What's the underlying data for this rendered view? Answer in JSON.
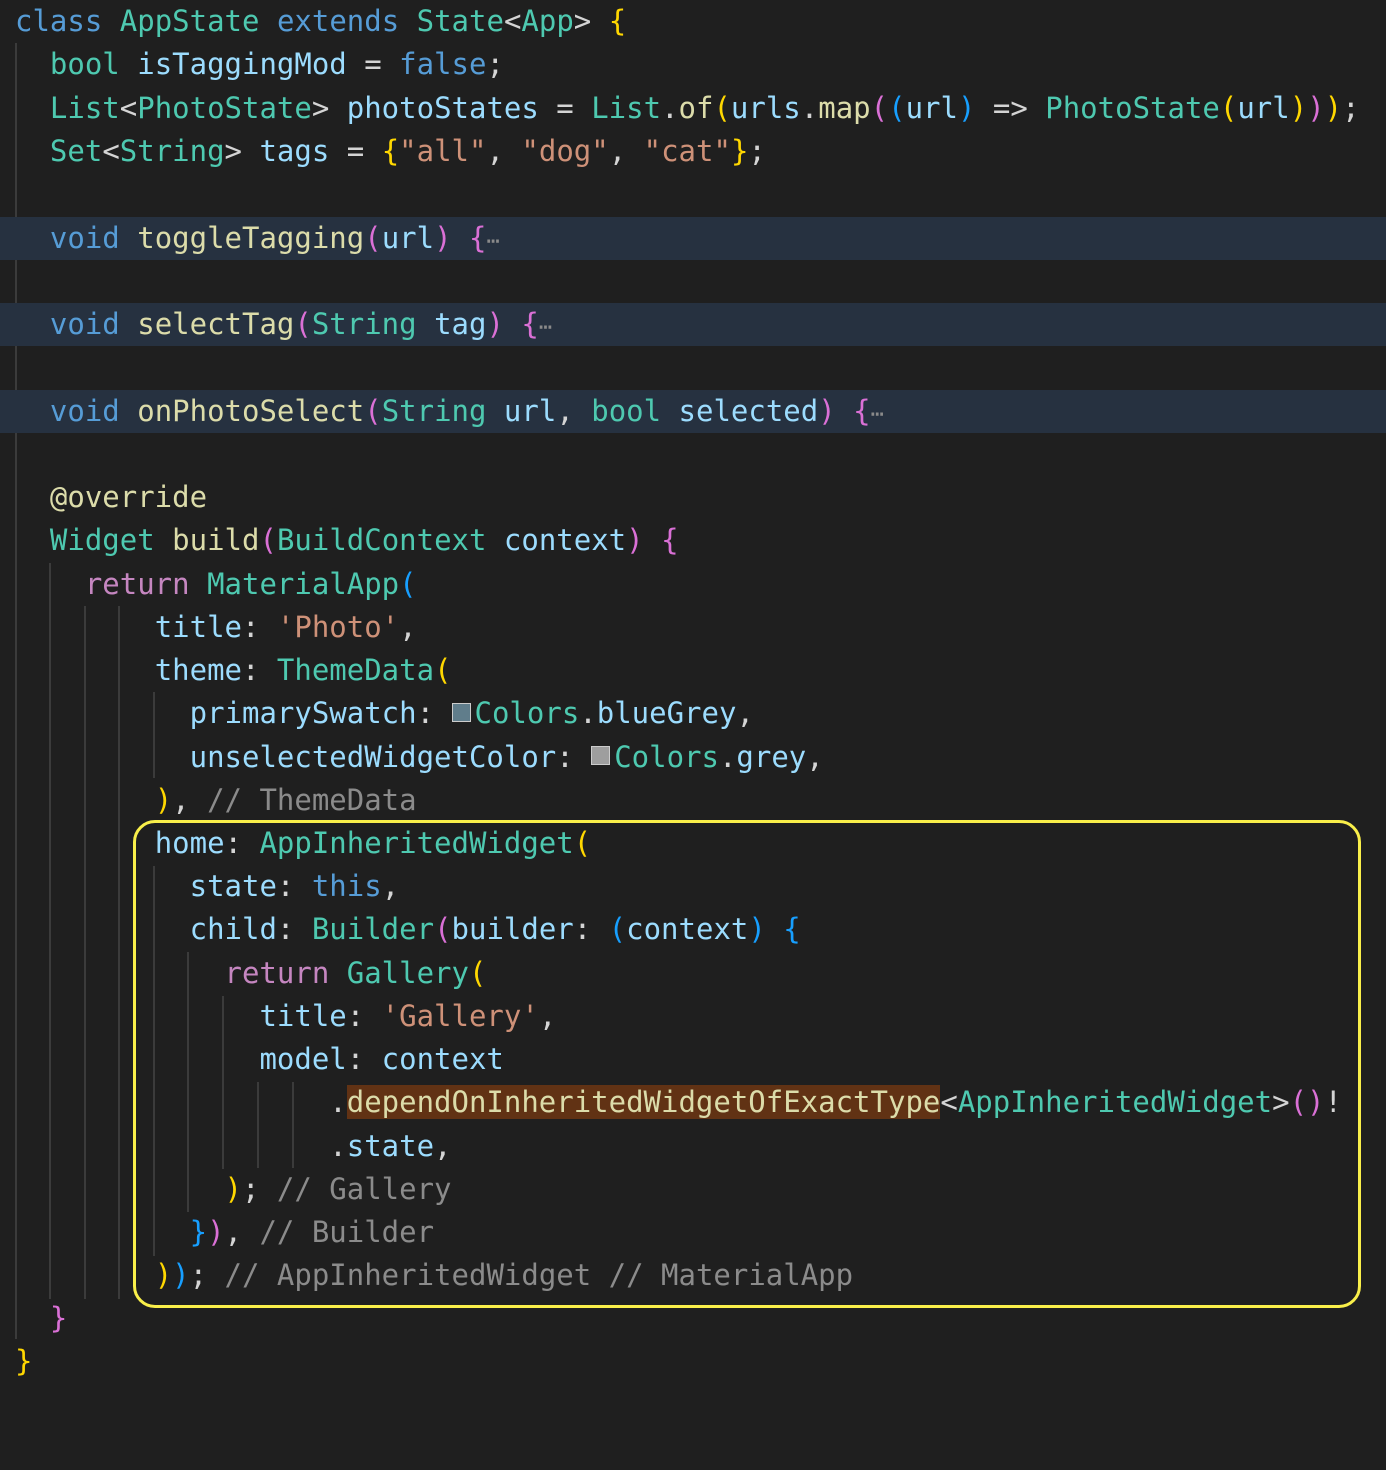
{
  "code": {
    "class_kw": "class",
    "class_name": "AppState",
    "extends_kw": "extends",
    "super_type": "State",
    "type_arg": "App",
    "field_bool_type": "bool",
    "field_tagging_name": "isTaggingMod",
    "false_kw": "false",
    "list_type": "List",
    "photostate_type": "PhotoState",
    "photostates_name": "photoStates",
    "list_of": "of",
    "urls": "urls",
    "map_fn": "map",
    "url": "url",
    "set_type": "Set",
    "string_type": "String",
    "tags_name": "tags",
    "tag_all": "\"all\"",
    "tag_dog": "\"dog\"",
    "tag_cat": "\"cat\"",
    "void_kw": "void",
    "toggle_fn": "toggleTagging",
    "select_tag_fn": "selectTag",
    "tag_param": "tag",
    "photo_select_fn": "onPhotoSelect",
    "selected_param": "selected",
    "fold_ellipsis": "⋯",
    "override": "@override",
    "widget_type": "Widget",
    "build_fn": "build",
    "buildcontext_type": "BuildContext",
    "context": "context",
    "return_kw": "return",
    "material_app": "MaterialApp",
    "title_prop": "title",
    "photo_str": "'Photo'",
    "theme_prop": "theme",
    "themedata": "ThemeData",
    "primary_swatch": "primarySwatch",
    "colors": "Colors",
    "blue_grey": "blueGrey",
    "unselected_color": "unselectedWidgetColor",
    "grey": "grey",
    "comment_themedata": "// ThemeData",
    "home_prop": "home",
    "app_inherited": "AppInheritedWidget",
    "state_prop": "state",
    "this_kw": "this",
    "child_prop": "child",
    "builder_type": "Builder",
    "builder_prop": "builder",
    "gallery": "Gallery",
    "gallery_str": "'Gallery'",
    "model_prop": "model",
    "depend_fn": "dependOnInheritedWidgetOfExactType",
    "state_access": "state",
    "comment_gallery": "// Gallery",
    "comment_builder": "// Builder",
    "comment_final": "// AppInheritedWidget // MaterialApp"
  },
  "colors": {
    "background": "#1f1f1f",
    "fold_line": "#263140",
    "highlight_box": "#f9ef4a",
    "swatch_blue_grey": "#607d8b",
    "swatch_grey": "#9e9e9e"
  }
}
